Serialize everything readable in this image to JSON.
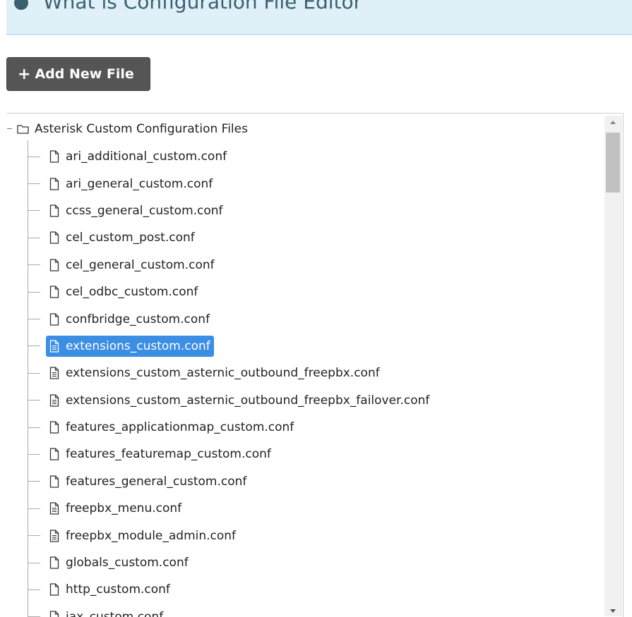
{
  "info_banner": {
    "text": "What is Configuration File Editor",
    "icon": "info-circle-icon"
  },
  "toolbar": {
    "add_new_file_label": "Add New File",
    "add_icon": "plus-icon"
  },
  "tree": {
    "root_label": "Asterisk Custom Configuration Files",
    "root_icon": "folder-icon",
    "items": [
      {
        "label": "ari_additional_custom.conf",
        "icon": "file-icon"
      },
      {
        "label": "ari_general_custom.conf",
        "icon": "file-icon"
      },
      {
        "label": "ccss_general_custom.conf",
        "icon": "file-icon"
      },
      {
        "label": "cel_custom_post.conf",
        "icon": "file-icon"
      },
      {
        "label": "cel_general_custom.conf",
        "icon": "file-icon"
      },
      {
        "label": "cel_odbc_custom.conf",
        "icon": "file-icon"
      },
      {
        "label": "confbridge_custom.conf",
        "icon": "file-icon"
      },
      {
        "label": "extensions_custom.conf",
        "icon": "file-text-icon",
        "selected": true
      },
      {
        "label": "extensions_custom_asternic_outbound_freepbx.conf",
        "icon": "file-text-icon"
      },
      {
        "label": "extensions_custom_asternic_outbound_freepbx_failover.conf",
        "icon": "file-text-icon"
      },
      {
        "label": "features_applicationmap_custom.conf",
        "icon": "file-icon"
      },
      {
        "label": "features_featuremap_custom.conf",
        "icon": "file-icon"
      },
      {
        "label": "features_general_custom.conf",
        "icon": "file-icon"
      },
      {
        "label": "freepbx_menu.conf",
        "icon": "file-text-icon"
      },
      {
        "label": "freepbx_module_admin.conf",
        "icon": "file-text-icon"
      },
      {
        "label": "globals_custom.conf",
        "icon": "file-icon"
      },
      {
        "label": "http_custom.conf",
        "icon": "file-icon"
      },
      {
        "label": "iax_custom.conf",
        "icon": "file-icon"
      }
    ]
  },
  "colors": {
    "selected_background": "#3b8ee3",
    "button_background": "#555555",
    "banner_background": "#dff0f8"
  }
}
